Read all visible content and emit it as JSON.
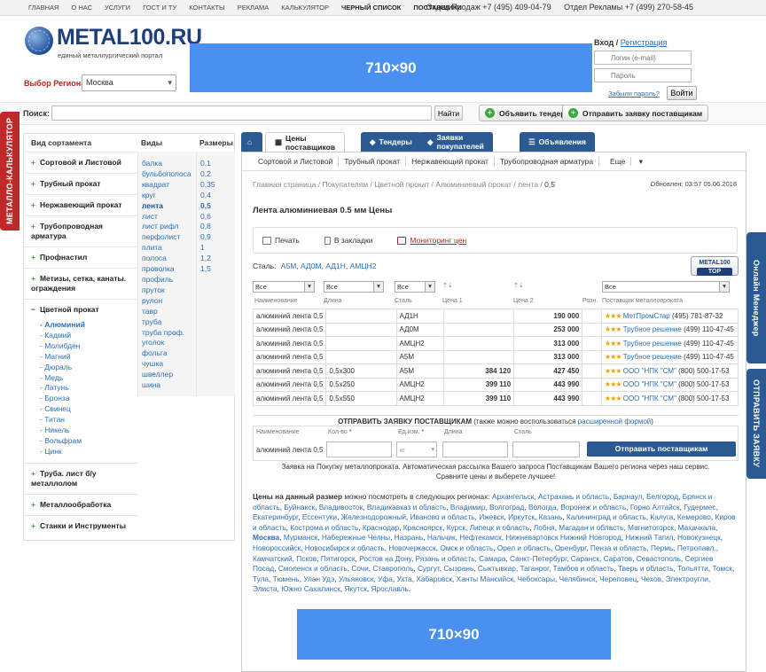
{
  "topnav": {
    "links": [
      "ГЛАВНАЯ",
      "О НАС",
      "УСЛУГИ",
      "ГОСТ И ТУ",
      "КОНТАКТЫ",
      "РЕКЛАМА",
      "КАЛЬКУЛЯТОР",
      "ЧЕРНЫЙ СПИСОК",
      "ПОСТАВЩИКИ"
    ],
    "sales_phone": "Отдел Продаж +7 (495) 409-04-79",
    "ads_phone": "Отдел Рекламы +7 (499) 270-58-45"
  },
  "logo": {
    "name": "METAL100.RU",
    "tagline": "единый металлургический портал"
  },
  "region": {
    "label": "Выбор Региона:",
    "value": "Москва"
  },
  "banners": {
    "top": "710×90",
    "bottom": "710×90"
  },
  "login": {
    "title": "Вход",
    "register": "Регистрация",
    "login_placeholder": "Логин (e-mail)",
    "password_placeholder": "Пароль",
    "forgot": "Забыли пароль?",
    "submit": "Войти"
  },
  "search": {
    "label": "Поиск:",
    "button": "Найти"
  },
  "actions": {
    "tender": "Объявить тендер",
    "request": "Отправить заявку поставщикам"
  },
  "side_tabs": {
    "calculator": "МЕТАЛЛО-КАЛЬКУЛЯТОР",
    "manager": "Онлайн Менеджер",
    "request": "ОТПРАВИТЬ ЗАЯВКУ"
  },
  "sidebar": {
    "headers": {
      "assortment": "Вид сортамента",
      "types": "Виды",
      "sizes": "Размеры"
    },
    "categories": [
      {
        "sign": "+",
        "label": "Сортовой и Листовой"
      },
      {
        "sign": "+",
        "label": "Трубный прокат"
      },
      {
        "sign": "+",
        "label": "Нержавеющий прокат"
      },
      {
        "sign": "+",
        "label": "Трубопроводная арматура"
      },
      {
        "sign": "+",
        "label": "Профнастил"
      },
      {
        "sign": "+",
        "label": "Метизы, сетка, канаты. ограждения"
      },
      {
        "sign": "−",
        "label": "Цветной прокат"
      }
    ],
    "subcategories": [
      "Алюминий",
      "Кадмий",
      "Молибден",
      "Магний",
      "Дюраль",
      "Медь",
      "Латунь",
      "Бронза",
      "Свинец",
      "Титан",
      "Никель",
      "Вольфрам",
      "Цинк"
    ],
    "categories_bottom": [
      {
        "sign": "+",
        "label": "Труба. лист б/у металлолом"
      },
      {
        "sign": "+",
        "label": "Металлообработка"
      },
      {
        "sign": "+",
        "label": "Станки и Инструменты"
      }
    ],
    "types": [
      "балка",
      "бульбополоса",
      "квадрат",
      "круг",
      "лента",
      "лист",
      "лист рифл",
      "перфолист",
      "плита",
      "полоса",
      "проволка",
      "профиль",
      "пруток",
      "рулон",
      "тавр",
      "труба",
      "труба проф.",
      "уголок",
      "фольга",
      "чушка",
      "швеллер",
      "шина"
    ],
    "sizes": [
      "0,1",
      "0,2",
      "0,35",
      "0,4",
      "0,5",
      "0,6",
      "0,8",
      "0,9",
      "1",
      "1,2",
      "1,5"
    ]
  },
  "tabs": {
    "home": "⌂",
    "suppliers": "Цены поставщиков",
    "tenders": "Тендеры",
    "buyers": "Заявки покупателей",
    "ads": "Объявления"
  },
  "subtabs": [
    "Сортовой и Листовой",
    "Трубный прокат",
    "Нержавеющий прокат",
    "Трубопроводная арматура",
    "Еще"
  ],
  "breadcrumbs": {
    "path": "Главная страница / Покупателям / Цветной прокат / Алюминиевый прокат / лента / ",
    "current": "0,5"
  },
  "updated": "Обновлен: 03:57 05.06.2018",
  "page_title": "Лента алюминиевая 0.5 мм Цены",
  "toolbar": {
    "print": "Печать",
    "bookmark": "В закладки",
    "monitor": "Мониторинг цен"
  },
  "steel": {
    "label": "Сталь:",
    "grades": [
      "А5М",
      "АД0М",
      "АД1Н",
      "АМЦН2"
    ]
  },
  "badge": {
    "name": "METAL100",
    "label": "TOP"
  },
  "filters": {
    "all": "Все"
  },
  "columns": [
    "Наименование",
    "Длина",
    "Сталь",
    "Цена 1",
    "Цена 2",
    "Розн.",
    "Поставщик металлопроката"
  ],
  "rows": [
    {
      "name": "алюминий лента 0,5",
      "length": "",
      "steel": "АД1Н",
      "price1": "",
      "price2": "190 000",
      "stars": "★★★",
      "supplier": "МетПромСтар",
      "phone": "(495) 781-87-32"
    },
    {
      "name": "алюминий лента 0,5",
      "length": "",
      "steel": "АД0М",
      "price1": "",
      "price2": "253 000",
      "stars": "★★★",
      "supplier": "Трубное решение",
      "phone": "(499) 110-47-45"
    },
    {
      "name": "алюминий лента 0,5",
      "length": "",
      "steel": "АМЦН2",
      "price1": "",
      "price2": "313 000",
      "stars": "★★★",
      "supplier": "Трубное решение",
      "phone": "(499) 110-47-45"
    },
    {
      "name": "алюминий лента 0,5",
      "length": "",
      "steel": "А5М",
      "price1": "",
      "price2": "313 000",
      "stars": "★★★",
      "supplier": "Трубное решение",
      "phone": "(499) 110-47-45"
    },
    {
      "name": "алюминий лента 0,5",
      "length": "0,5х300",
      "steel": "А5М",
      "price1": "384 120",
      "price2": "427 450",
      "stars": "★★★",
      "supplier": "ООО \"НПК \"СМ\"",
      "phone": "(800) 500-17-53"
    },
    {
      "name": "алюминий лента 0,5",
      "length": "0,5х250",
      "steel": "АМЦН2",
      "price1": "399 110",
      "price2": "443 990",
      "stars": "★★★",
      "supplier": "ООО \"НПК \"СМ\"",
      "phone": "(800) 500-17-53"
    },
    {
      "name": "алюминий лента 0,5",
      "length": "0,5х550",
      "steel": "АМЦН2",
      "price1": "399 110",
      "price2": "443 990",
      "stars": "★★★",
      "supplier": "ООО \"НПК \"СМ\"",
      "phone": "(800) 500-17-53"
    }
  ],
  "send": {
    "title": "ОТПРАВИТЬ ЗАЯВКУ ПОСТАВЩИКАМ",
    "note_pre": "(также можно воспользоваться ",
    "note_link": "расширенной формой",
    "note_post": ")",
    "labels": {
      "name": "Наименование",
      "qty": "Кол-во",
      "unit": "Ед.изм.",
      "length": "Длина",
      "steel": "Сталь"
    },
    "name_value": "алюминий лента 0,5",
    "unit_value": "кг",
    "button": "Отправить поставщикам"
  },
  "note": {
    "line1": "Заявка на Покупку металлопроката. Автоматическая рассылка Вашего запроса Поставщикам Вашего региона через наш сервис.",
    "line2": "Сравните цены и выберете лучшее!"
  },
  "regions": {
    "lead_bold": "Цены на данный размер",
    "lead_text": " можно посмотреть в следующих регионах: ",
    "list": [
      "Архангельск",
      "Астрахань и область",
      "Барнаул",
      "Белгород",
      "Брянск и область",
      "Буйнакск",
      "Владивосток",
      "Владикавказ и область",
      "Владимир",
      "Волгоград",
      "Вологда",
      "Воронеж и область",
      "Горно Алтайск",
      "Гудермес",
      "Екатеринбург",
      "Ессентуки",
      "Железнодорожный",
      "Иваново и область",
      "Ижевск",
      "Иркутск",
      "Казань",
      "Калининград и область",
      "Калуга",
      "Кемерово",
      "Киров и область",
      "Кострома и область",
      "Краснодар",
      "Красноярск",
      "Курск",
      "Липецк и область",
      "Лобня",
      "Магадан и область",
      "Магнитогорск",
      "Махачкала",
      "Москва",
      "Мурманск",
      "Набережные Челны",
      "Назрань",
      "Нальчик",
      "Нефтекамск",
      "Нижневартовск Нижний Новгород",
      "Нижний Тагил",
      "Новокузнецк",
      "Новороссийск",
      "Новосибирск и область",
      "Новочеркасск",
      "Омск и область",
      "Орел и область",
      "Оренбург",
      "Пенза и область",
      "Пермь",
      "Петропавл.",
      "Камчатский",
      "Псков",
      "Пятигорск",
      "Ростов на Дону",
      "Рязань и область",
      "Самара",
      "Санкт-Петербург",
      "Саранск",
      "Саратов",
      "Севастополь",
      "Сергиев Посад",
      "Смоленск и область",
      "Сочи",
      "Ставрополь",
      "Сургут",
      "Сызрань",
      "Сыктывкар",
      "Таганрог",
      "Тамбов и область",
      "Тверь и область",
      "Тольятти",
      "Томск",
      "Тула",
      "Тюмень",
      "Улан Удэ",
      "Ульяновск",
      "Уфа",
      "Ухта",
      "Хабаровск",
      "Ханты Мансийск",
      "Чебоксары",
      "Челябинск",
      "Череповец",
      "Чехов",
      "Электроугли",
      "Элиста",
      "Южно Сахалинск",
      "Якутск",
      "Ярославль"
    ],
    "bold_item": "Москва"
  }
}
